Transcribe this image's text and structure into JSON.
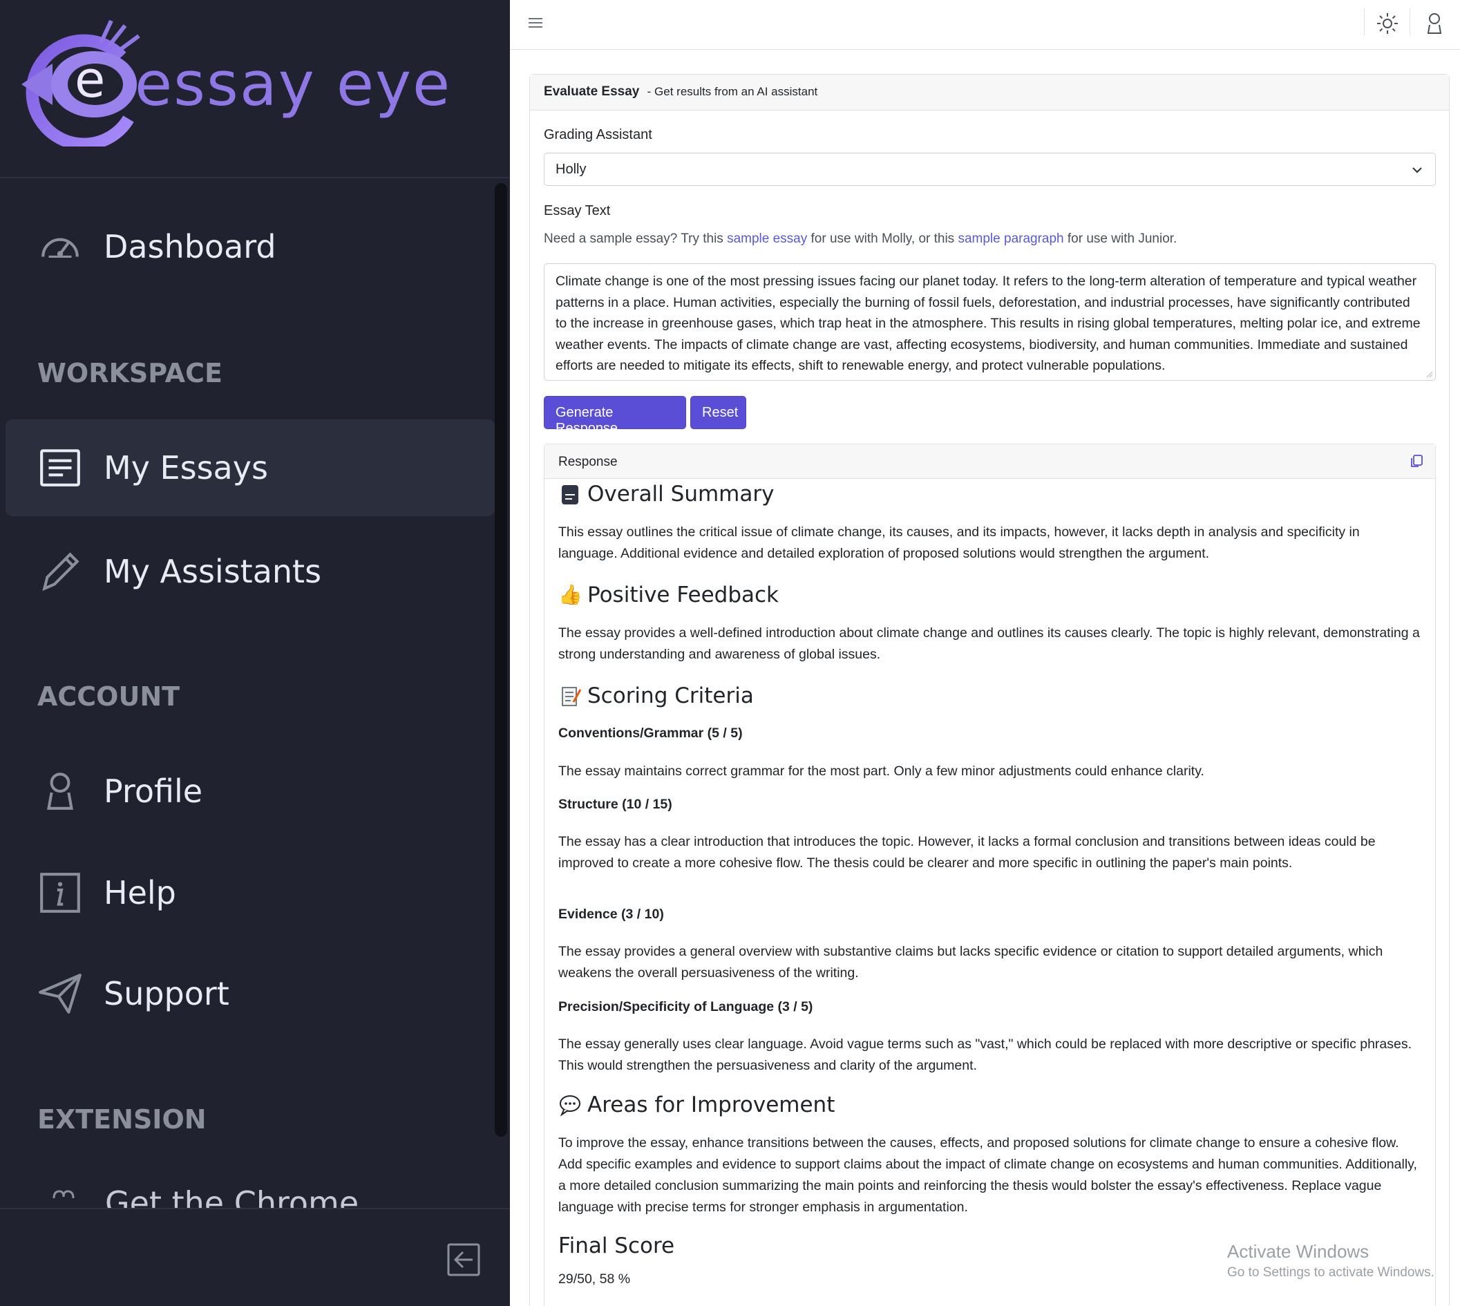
{
  "app": {
    "logo_text": "essay eye",
    "brand_color": "#8f78e6",
    "accent_color": "#5b4ed6"
  },
  "sidebar": {
    "dashboard": {
      "label": "Dashboard",
      "icon": "speedometer-icon"
    },
    "sections": {
      "workspace": "WORKSPACE",
      "account": "ACCOUNT",
      "extension": "EXTENSION"
    },
    "workspace_items": [
      {
        "label": "My Essays",
        "icon": "document-lines-icon",
        "active": true
      },
      {
        "label": "My Assistants",
        "icon": "pencil-icon",
        "active": false
      }
    ],
    "account_items": [
      {
        "label": "Profile",
        "icon": "person-icon"
      },
      {
        "label": "Help",
        "icon": "info-icon"
      },
      {
        "label": "Support",
        "icon": "send-icon"
      }
    ],
    "extension_item_partial": "Get the Chrome Extension",
    "collapse_icon": "collapse-left-icon"
  },
  "topbar": {
    "menu_icon": "hamburger-icon",
    "theme_icon": "sun-icon",
    "user_icon": "person-icon"
  },
  "evaluate": {
    "title": "Evaluate Essay",
    "subtitle": "- Get results from an AI assistant",
    "grading_label": "Grading Assistant",
    "grading_value": "Holly",
    "essay_label": "Essay Text",
    "hint_prefix": "Need a sample essay? Try this ",
    "hint_link1": "sample essay",
    "hint_middle": " for use with Molly, or this ",
    "hint_link2": "sample paragraph",
    "hint_suffix": " for use with Junior.",
    "essay_text": "Climate change is one of the most pressing issues facing our planet today. It refers to the long-term alteration of temperature and typical weather patterns in a place. Human activities, especially the burning of fossil fuels, deforestation, and industrial processes, have significantly contributed to the increase in greenhouse gases, which trap heat in the atmosphere. This results in rising global temperatures, melting polar ice, and extreme weather events. The impacts of climate change are vast, affecting ecosystems, biodiversity, and human communities. Immediate and sustained efforts are needed to mitigate its effects, shift to renewable energy, and protect vulnerable populations.",
    "generate_label": "Generate Response",
    "reset_label": "Reset"
  },
  "response": {
    "header": "Response",
    "summary_title": "Overall Summary",
    "summary_text": "This essay outlines the critical issue of climate change, its causes, and its impacts, however, it lacks depth in analysis and specificity in language. Additional evidence and detailed exploration of proposed solutions would strengthen the argument.",
    "positive_title": "Positive Feedback",
    "positive_text": "The essay provides a well-defined introduction about climate change and outlines its causes clearly. The topic is highly relevant, demonstrating a strong understanding and awareness of global issues.",
    "criteria_title": "Scoring Criteria",
    "criteria": [
      {
        "name": "Conventions/Grammar (5 / 5)",
        "text": "The essay maintains correct grammar for the most part. Only a few minor adjustments could enhance clarity."
      },
      {
        "name": "Structure (10 / 15)",
        "text": "The essay has a clear introduction that introduces the topic. However, it lacks a formal conclusion and transitions between ideas could be improved to create a more cohesive flow. The thesis could be clearer and more specific in outlining the paper's main points."
      },
      {
        "name": "Evidence (3 / 10)",
        "text": "The essay provides a general overview with substantive claims but lacks specific evidence or citation to support detailed arguments, which weakens the overall persuasiveness of the writing."
      },
      {
        "name": "Precision/Specificity of Language (3 / 5)",
        "text": "The essay generally uses clear language. Avoid vague terms such as \"vast,\" which could be replaced with more descriptive or specific phrases. This would strengthen the persuasiveness and clarity of the argument."
      }
    ],
    "improvement_title": "Areas for Improvement",
    "improvement_text": "To improve the essay, enhance transitions between the causes, effects, and proposed solutions for climate change to ensure a cohesive flow. Add specific examples and evidence to support claims about the impact of climate change on ecosystems and human communities. Additionally, a more detailed conclusion summarizing the main points and reinforcing the thesis would bolster the essay's effectiveness. Replace vague language with precise terms for stronger emphasis in argumentation.",
    "final_title": "Final Score",
    "final_score": "29/50, 58 %"
  },
  "watermark": {
    "line1": "Activate Windows",
    "line2": "Go to Settings to activate Windows."
  }
}
